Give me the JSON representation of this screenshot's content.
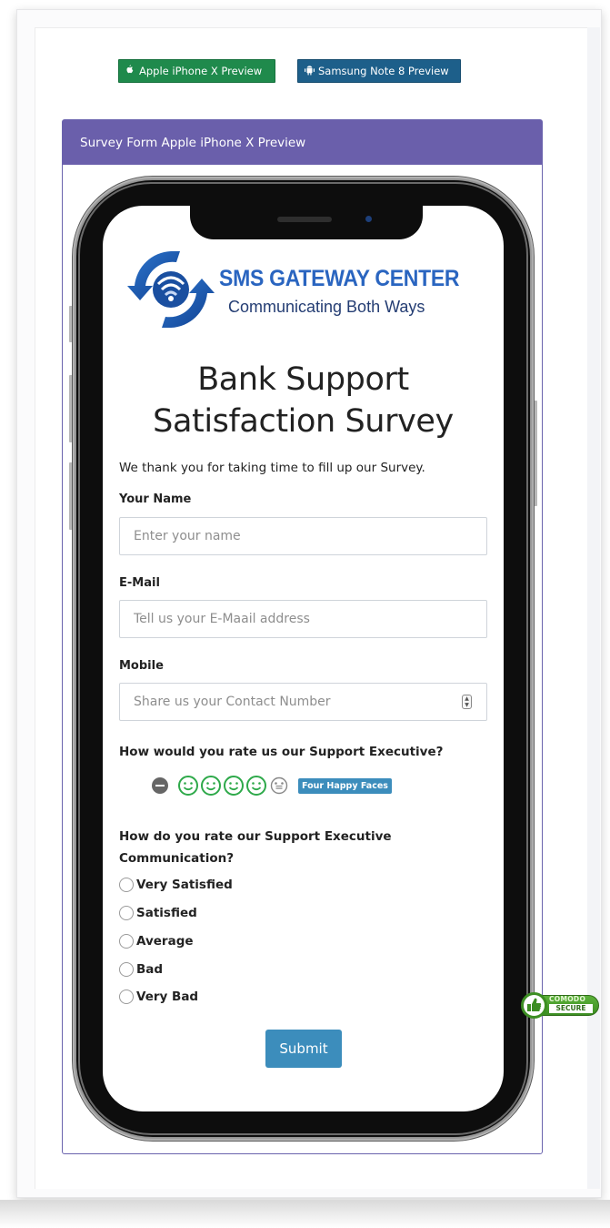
{
  "preview_buttons": {
    "apple": {
      "label": "Apple iPhone X Preview",
      "icon": "apple-icon"
    },
    "samsung": {
      "label": "Samsung Note 8 Preview",
      "icon": "android-icon"
    }
  },
  "panel": {
    "title": "Survey Form Apple iPhone X Preview"
  },
  "logo": {
    "title": "SMS GATEWAY CENTER",
    "subtitle": "Communicating Both Ways"
  },
  "survey": {
    "title_line1": "Bank Support",
    "title_line2": "Satisfaction Survey",
    "intro": "We thank you for taking time to fill up our Survey.",
    "fields": {
      "name": {
        "label": "Your Name",
        "placeholder": "Enter your name"
      },
      "email": {
        "label": "E-Mail",
        "placeholder": "Tell us your E-Maail address"
      },
      "mobile": {
        "label": "Mobile",
        "placeholder": "Share us your Contact Number"
      }
    },
    "rating": {
      "question": "How would you rate us our Support Executive?",
      "value": 4,
      "max": 5,
      "badge": "Four Happy Faces"
    },
    "communication": {
      "question_line1": "How do you rate our Support Executive",
      "question_line2": "Communication?",
      "options": [
        "Very Satisfied",
        "Satisfied",
        "Average",
        "Bad",
        "Very Bad"
      ]
    },
    "submit_label": "Submit"
  },
  "trust_badge": {
    "top": "COMODO",
    "bottom": "SECURE"
  },
  "colors": {
    "apple_button": "#1f8a4c",
    "samsung_button": "#1d5f8a",
    "panel_header": "#6a5fab",
    "primary": "#3c8dbc",
    "happy_face": "#2ea94a",
    "neutral_face": "#888888"
  }
}
